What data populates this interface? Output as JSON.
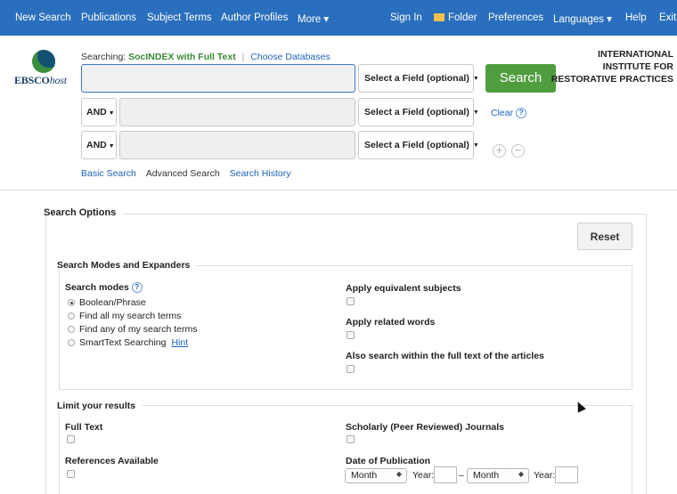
{
  "topnav": {
    "new_search": "New Search",
    "publications": "Publications",
    "subject_terms": "Subject Terms",
    "author_profiles": "Author Profiles",
    "more": "More ▾",
    "sign_in": "Sign In",
    "folder": "Folder",
    "preferences": "Preferences",
    "languages": "Languages ▾",
    "help": "Help",
    "exit": "Exit"
  },
  "logo": {
    "brand": "EBSCO",
    "brand_suffix": "host"
  },
  "searching": {
    "prefix": "Searching:",
    "database": "SocINDEX with Full Text",
    "choose": "Choose Databases"
  },
  "rows": [
    {
      "field": "Select a Field (optional)",
      "value": ""
    },
    {
      "operator": "AND",
      "field": "Select a Field (optional)",
      "value": ""
    },
    {
      "operator": "AND",
      "field": "Select a Field (optional)",
      "value": ""
    }
  ],
  "search_button": "Search",
  "org": {
    "line1": "INTERNATIONAL",
    "line2": "INSTITUTE FOR",
    "line3": "RESTORATIVE PRACTICES"
  },
  "clear": "Clear",
  "help_glyph": "?",
  "add_row_glyph": "+",
  "remove_row_glyph": "−",
  "modes": {
    "basic": "Basic Search",
    "advanced": "Advanced Search",
    "history": "Search History"
  },
  "options": {
    "title": "Search Options",
    "reset": "Reset",
    "modes_section": "Search Modes and Expanders",
    "search_modes_label": "Search modes",
    "search_modes": [
      {
        "label": "Boolean/Phrase",
        "selected": true
      },
      {
        "label": "Find all my search terms",
        "selected": false
      },
      {
        "label": "Find any of my search terms",
        "selected": false
      },
      {
        "label": "SmartText Searching",
        "selected": false
      }
    ],
    "hint": "Hint",
    "apply_equivalent": "Apply equivalent subjects",
    "apply_related": "Apply related words",
    "also_fulltext": "Also search within the full text of the articles",
    "limit_section": "Limit your results",
    "full_text": "Full Text",
    "scholarly": "Scholarly (Peer Reviewed) Journals",
    "references": "References Available",
    "date_pub": "Date of Publication",
    "month1": "Month",
    "year_label": "Year:",
    "dash": "–",
    "month2": "Month"
  }
}
